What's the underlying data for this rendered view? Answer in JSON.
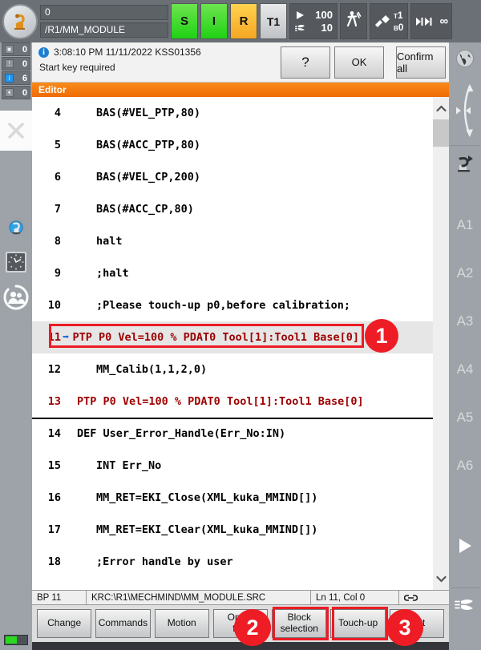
{
  "topbar": {
    "robot_icon": "robot-arm-icon",
    "submit_id": "0",
    "module_path": "/R1/MM_MODULE",
    "status_buttons": [
      {
        "label": "S",
        "color": "#28d618",
        "name": "status-s"
      },
      {
        "label": "I",
        "color": "#28d618",
        "name": "status-i"
      },
      {
        "label": "R",
        "color": "#f5a623",
        "name": "status-r"
      },
      {
        "label": "T1",
        "color": "#cfd2d5",
        "name": "status-mode-t1"
      }
    ],
    "override_program": "100",
    "override_jog": "10",
    "walk_icon": "pedestrian-icon",
    "tool_label": "T",
    "tool_value": "1",
    "base_label": "B",
    "base_value": "0",
    "increment": "∞",
    "incr_icon": "increment-jog-icon"
  },
  "left_rail": {
    "message_counts": [
      {
        "icon": "ack-message-icon",
        "count": "0",
        "active": false
      },
      {
        "icon": "warning-message-icon",
        "count": "0",
        "active": false
      },
      {
        "icon": "info-message-icon",
        "count": "6",
        "active": true
      },
      {
        "icon": "wait-message-icon",
        "count": "0",
        "active": false
      }
    ],
    "close_icon": "close-x-icon",
    "icons": [
      "settings-gear-robot-icon",
      "clock-icon",
      "user-group-icon"
    ],
    "battery_icon": "battery-indicator"
  },
  "right_rail": {
    "globe_icon": "world-coordinates-icon",
    "motion_icon": "jog-direction-icon",
    "robot_icon": "robot-axis-icon",
    "axes": [
      "A1",
      "A2",
      "A3",
      "A4",
      "A5",
      "A6"
    ],
    "play_icon": "play-icon",
    "hand_icon": "hand-jog-icon"
  },
  "message": {
    "info_icon": "info-icon",
    "timestamp": "3:08:10 PM 11/11/2022 KSS01356",
    "text": "Start key required",
    "help_label": "?",
    "ok_label": "OK",
    "confirm_all_label": "Confirm all"
  },
  "editor": {
    "title": "Editor",
    "lines": [
      {
        "num": "4",
        "text": "BAS(#VEL_PTP,80)",
        "indent": 1,
        "red": false,
        "selected": false
      },
      {
        "num": "5",
        "text": "BAS(#ACC_PTP,80)",
        "indent": 1,
        "red": false,
        "selected": false
      },
      {
        "num": "6",
        "text": "BAS(#VEL_CP,200)",
        "indent": 1,
        "red": false,
        "selected": false
      },
      {
        "num": "7",
        "text": "BAS(#ACC_CP,80)",
        "indent": 1,
        "red": false,
        "selected": false
      },
      {
        "num": "8",
        "text": "halt",
        "indent": 1,
        "red": false,
        "selected": false
      },
      {
        "num": "9",
        "text": ";halt",
        "indent": 1,
        "red": false,
        "selected": false
      },
      {
        "num": "10",
        "text": ";Please touch-up p0,before calibration;",
        "indent": 1,
        "red": false,
        "selected": false
      },
      {
        "num": "11",
        "text": "PTP P0 Vel=100 % PDAT0 Tool[1]:Tool1 Base[0]",
        "indent": 0,
        "red": true,
        "selected": true
      },
      {
        "num": "12",
        "text": "MM_Calib(1,1,2,0)",
        "indent": 1,
        "red": false,
        "selected": false
      },
      {
        "num": "13",
        "text": "PTP P0 Vel=100 % PDAT0 Tool[1]:Tool1 Base[0]",
        "indent": 2,
        "red": true,
        "selected": false
      },
      {
        "num": "14",
        "text": "DEF User_Error_Handle(Err_No:IN)",
        "indent": 2,
        "red": false,
        "selected": false
      },
      {
        "num": "15",
        "text": "INT Err_No",
        "indent": 1,
        "red": false,
        "selected": false
      },
      {
        "num": "16",
        "text": "MM_RET=EKI_Close(XML_kuka_MMIND[])",
        "indent": 1,
        "red": false,
        "selected": false
      },
      {
        "num": "17",
        "text": "MM_RET=EKI_Clear(XML_kuka_MMIND[])",
        "indent": 1,
        "red": false,
        "selected": false
      },
      {
        "num": "18",
        "text": ";Error handle by user",
        "indent": 1,
        "red": false,
        "selected": false
      }
    ],
    "cursor_marker": "➡",
    "scroll_up_icon": "chevron-up-icon",
    "scroll_down_icon": "chevron-down-icon"
  },
  "statusbar": {
    "breakpoint": "BP 11",
    "file_path": "KRC:\\R1\\MECHMIND\\MM_MODULE.SRC",
    "cursor_position": "Ln 11, Col 0",
    "link_icon": "chain-link-icon"
  },
  "buttons": [
    {
      "label": "Change",
      "name": "change-button"
    },
    {
      "label": "Commands",
      "name": "commands-button"
    },
    {
      "label": "Motion",
      "name": "motion-button"
    },
    {
      "label": "Open/\nfold",
      "name": "open-fold-button"
    },
    {
      "label": "Block\nselection",
      "name": "block-selection-button"
    },
    {
      "label": "Touch-up",
      "name": "touch-up-button"
    },
    {
      "label": "Edit",
      "name": "edit-button"
    }
  ],
  "annotations": [
    {
      "number": "1",
      "target": "line-11-touchup-point"
    },
    {
      "number": "2",
      "target": "block-selection-button"
    },
    {
      "number": "3",
      "target": "touch-up-button"
    }
  ],
  "colors": {
    "accent_orange": "#ee6b05",
    "annotation_red": "#ee1c25",
    "code_red": "#9e0000",
    "rail_grey": "#9da3a9",
    "topbar_grey": "#6b7076"
  }
}
